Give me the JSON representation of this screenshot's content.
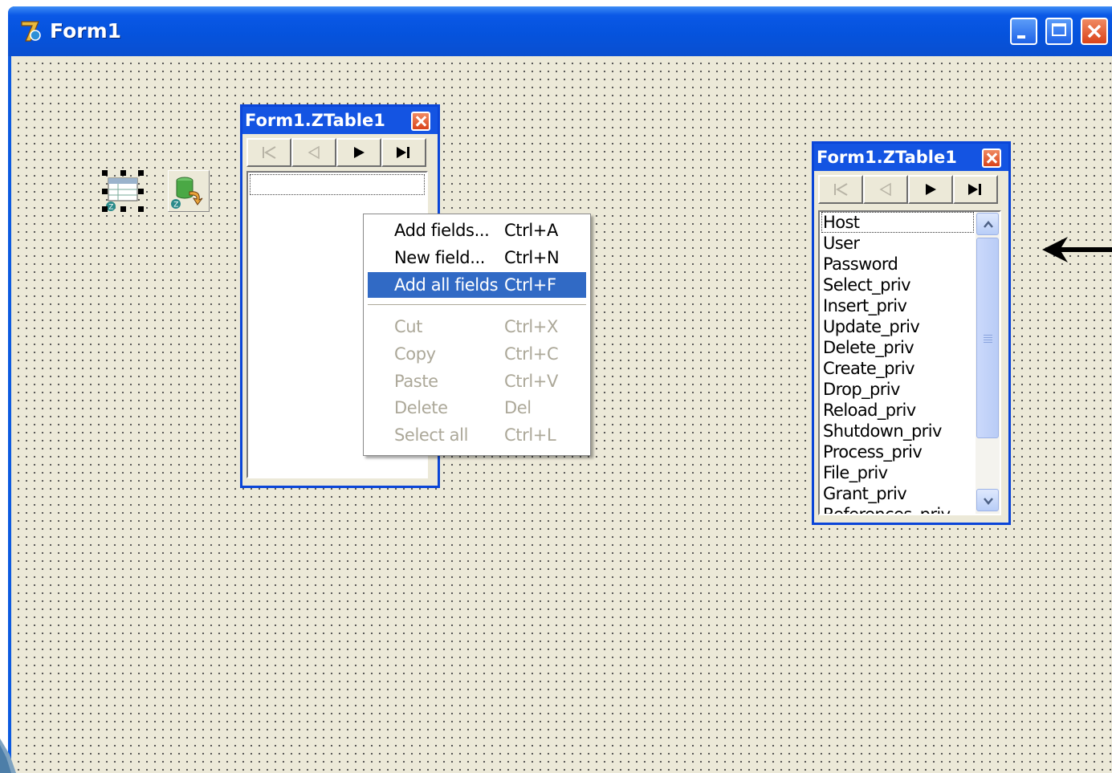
{
  "window": {
    "title": "Form1",
    "icon": "delphi-7-icon",
    "caption_buttons": [
      "minimize-icon",
      "maximize-icon",
      "close-icon"
    ]
  },
  "components": [
    {
      "name": "ztable-component-icon",
      "selected": true
    },
    {
      "name": "zupdatesql-component-icon",
      "selected": false
    }
  ],
  "editor_left": {
    "title": "Form1.ZTable1",
    "nav_buttons": [
      "first-record-icon",
      "prior-record-icon",
      "next-record-icon",
      "last-record-icon"
    ],
    "fields": []
  },
  "context_menu": {
    "items": [
      {
        "label": "Add fields...",
        "shortcut": "Ctrl+A",
        "state": "enabled"
      },
      {
        "label": "New field...",
        "shortcut": "Ctrl+N",
        "state": "enabled"
      },
      {
        "label": "Add all fields",
        "shortcut": "Ctrl+F",
        "state": "highlighted"
      },
      {
        "label": "Cut",
        "shortcut": "Ctrl+X",
        "state": "disabled"
      },
      {
        "label": "Copy",
        "shortcut": "Ctrl+C",
        "state": "disabled"
      },
      {
        "label": "Paste",
        "shortcut": "Ctrl+V",
        "state": "disabled"
      },
      {
        "label": "Delete",
        "shortcut": "Del",
        "state": "disabled"
      },
      {
        "label": "Select all",
        "shortcut": "Ctrl+L",
        "state": "disabled"
      }
    ]
  },
  "editor_right": {
    "title": "Form1.ZTable1",
    "nav_buttons": [
      "first-record-icon",
      "prior-record-icon",
      "next-record-icon",
      "last-record-icon"
    ],
    "fields": [
      "Host",
      "User",
      "Password",
      "Select_priv",
      "Insert_priv",
      "Update_priv",
      "Delete_priv",
      "Create_priv",
      "Drop_priv",
      "Reload_priv",
      "Shutdown_priv",
      "Process_priv",
      "File_priv",
      "Grant_priv",
      "References_priv"
    ]
  },
  "annotation": {
    "icon": "left-arrow-icon",
    "color": "#000000"
  },
  "colors": {
    "title_bar": "#0553dd",
    "form_background": "#ece9d8",
    "menu_highlight": "#316ac5",
    "disabled_text": "#aca899"
  }
}
